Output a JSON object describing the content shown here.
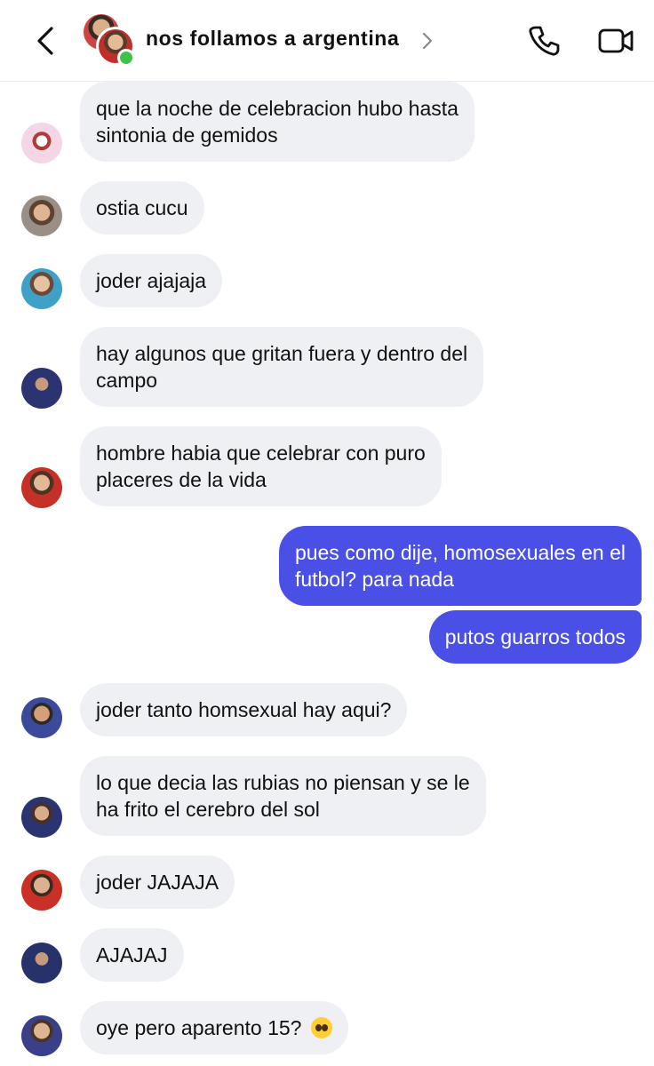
{
  "header": {
    "title": "nos follamos a argentina",
    "back_icon": "chevron-left-icon",
    "call_icon": "phone-icon",
    "video_icon": "video-camera-icon",
    "online_color": "#3fc24a"
  },
  "colors": {
    "incoming_bubble": "#eff0f3",
    "outgoing_bubble": "#4a4fe6"
  },
  "messages": [
    {
      "line1": "que la noche de celebracion hubo hasta",
      "line2": "sintonia de gemidos"
    },
    {
      "line1": "ostia cucu"
    },
    {
      "line1": "joder ajajaja"
    },
    {
      "line1": "hay algunos que gritan fuera y dentro del",
      "line2": "campo"
    },
    {
      "line1": "hombre habia que celebrar con puro",
      "line2": "placeres de la vida"
    },
    {
      "line1": "pues como dije, homosexuales en el",
      "line2": "futbol? para nada"
    },
    {
      "line1": "putos guarros todos"
    },
    {
      "line1": "joder tanto homsexual hay aqui?"
    },
    {
      "line1": "lo que decia las rubias no piensan y se le",
      "line2": "ha frito el cerebro del sol"
    },
    {
      "line1": "joder JAJAJA"
    },
    {
      "line1": "AJAJAJ"
    },
    {
      "line1": "oye pero aparento 15?",
      "emoji": "pleading-face-emoji"
    }
  ]
}
